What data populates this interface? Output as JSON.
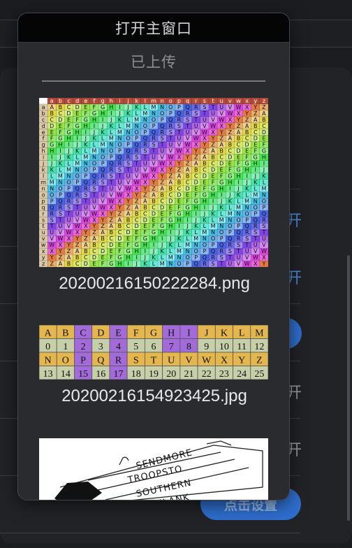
{
  "popup": {
    "title": "打开主窗口",
    "status": "已上传",
    "files": [
      {
        "name": "20200216150222284.png"
      },
      {
        "name": "20200216154923425.jpg"
      },
      {
        "name": ""
      }
    ]
  },
  "background": {
    "links": [
      "开",
      "开",
      "开",
      "开"
    ],
    "setup_button": "点击设置"
  },
  "thumb1": {
    "header": [
      "a",
      "b",
      "c",
      "d",
      "e",
      "f",
      "g",
      "h",
      "i",
      "j",
      "k",
      "l",
      "m",
      "n",
      "o",
      "p",
      "q",
      "r",
      "s",
      "t",
      "u",
      "v",
      "w",
      "x",
      "y",
      "z"
    ]
  },
  "thumb2": {
    "row1_letters": [
      "A",
      "B",
      "C",
      "D",
      "E",
      "F",
      "G",
      "H",
      "I",
      "J",
      "K",
      "L",
      "M"
    ],
    "row1_numbers": [
      "0",
      "1",
      "2",
      "3",
      "4",
      "5",
      "6",
      "7",
      "8",
      "9",
      "10",
      "11",
      "12"
    ],
    "row2_letters": [
      "N",
      "O",
      "P",
      "Q",
      "R",
      "S",
      "T",
      "U",
      "V",
      "W",
      "X",
      "Y",
      "Z"
    ],
    "row2_numbers": [
      "13",
      "14",
      "15",
      "16",
      "17",
      "18",
      "19",
      "20",
      "21",
      "22",
      "23",
      "24",
      "25"
    ]
  },
  "thumb3": {
    "ring_texts": [
      "SENDMORE",
      "TROOPSTO",
      "SOUTHERN",
      "FLANK"
    ]
  }
}
